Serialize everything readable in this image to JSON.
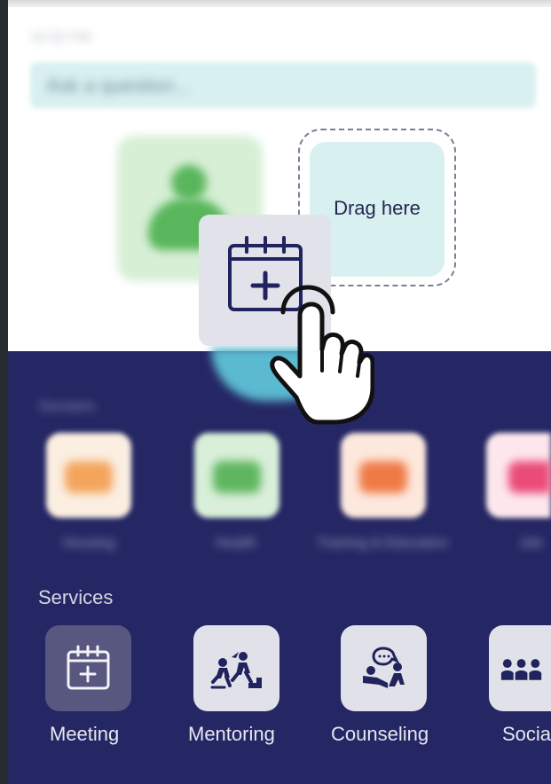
{
  "page": {
    "time": "10:32 PM",
    "search_placeholder": "Ask a question..."
  },
  "drag": {
    "target_label": "Drag here",
    "dragged_item_label": "Meeting"
  },
  "domains": {
    "section_label": "Domains",
    "items": [
      {
        "label": "Housing",
        "icon": "home-icon",
        "color": "#f3a55c"
      },
      {
        "label": "Health",
        "icon": "person-icon",
        "color": "#5fb65f"
      },
      {
        "label": "Training & Education",
        "icon": "book-icon",
        "color": "#f07a46"
      },
      {
        "label": "Job",
        "icon": "briefcase-icon",
        "color": "#ea4b78"
      }
    ]
  },
  "services": {
    "title": "Services",
    "items": [
      {
        "label": "Meeting",
        "icon": "calendar-plus-icon",
        "active": true
      },
      {
        "label": "Mentoring",
        "icon": "mentoring-icon",
        "active": false
      },
      {
        "label": "Counseling",
        "icon": "counseling-icon",
        "active": false
      },
      {
        "label": "Socia",
        "icon": "group-icon",
        "active": false
      }
    ]
  },
  "colors": {
    "accent_dark": "#252764",
    "drop_zone": "#d8f0f0",
    "service_active": "#58577f",
    "service_inactive": "#e1e1ea"
  }
}
